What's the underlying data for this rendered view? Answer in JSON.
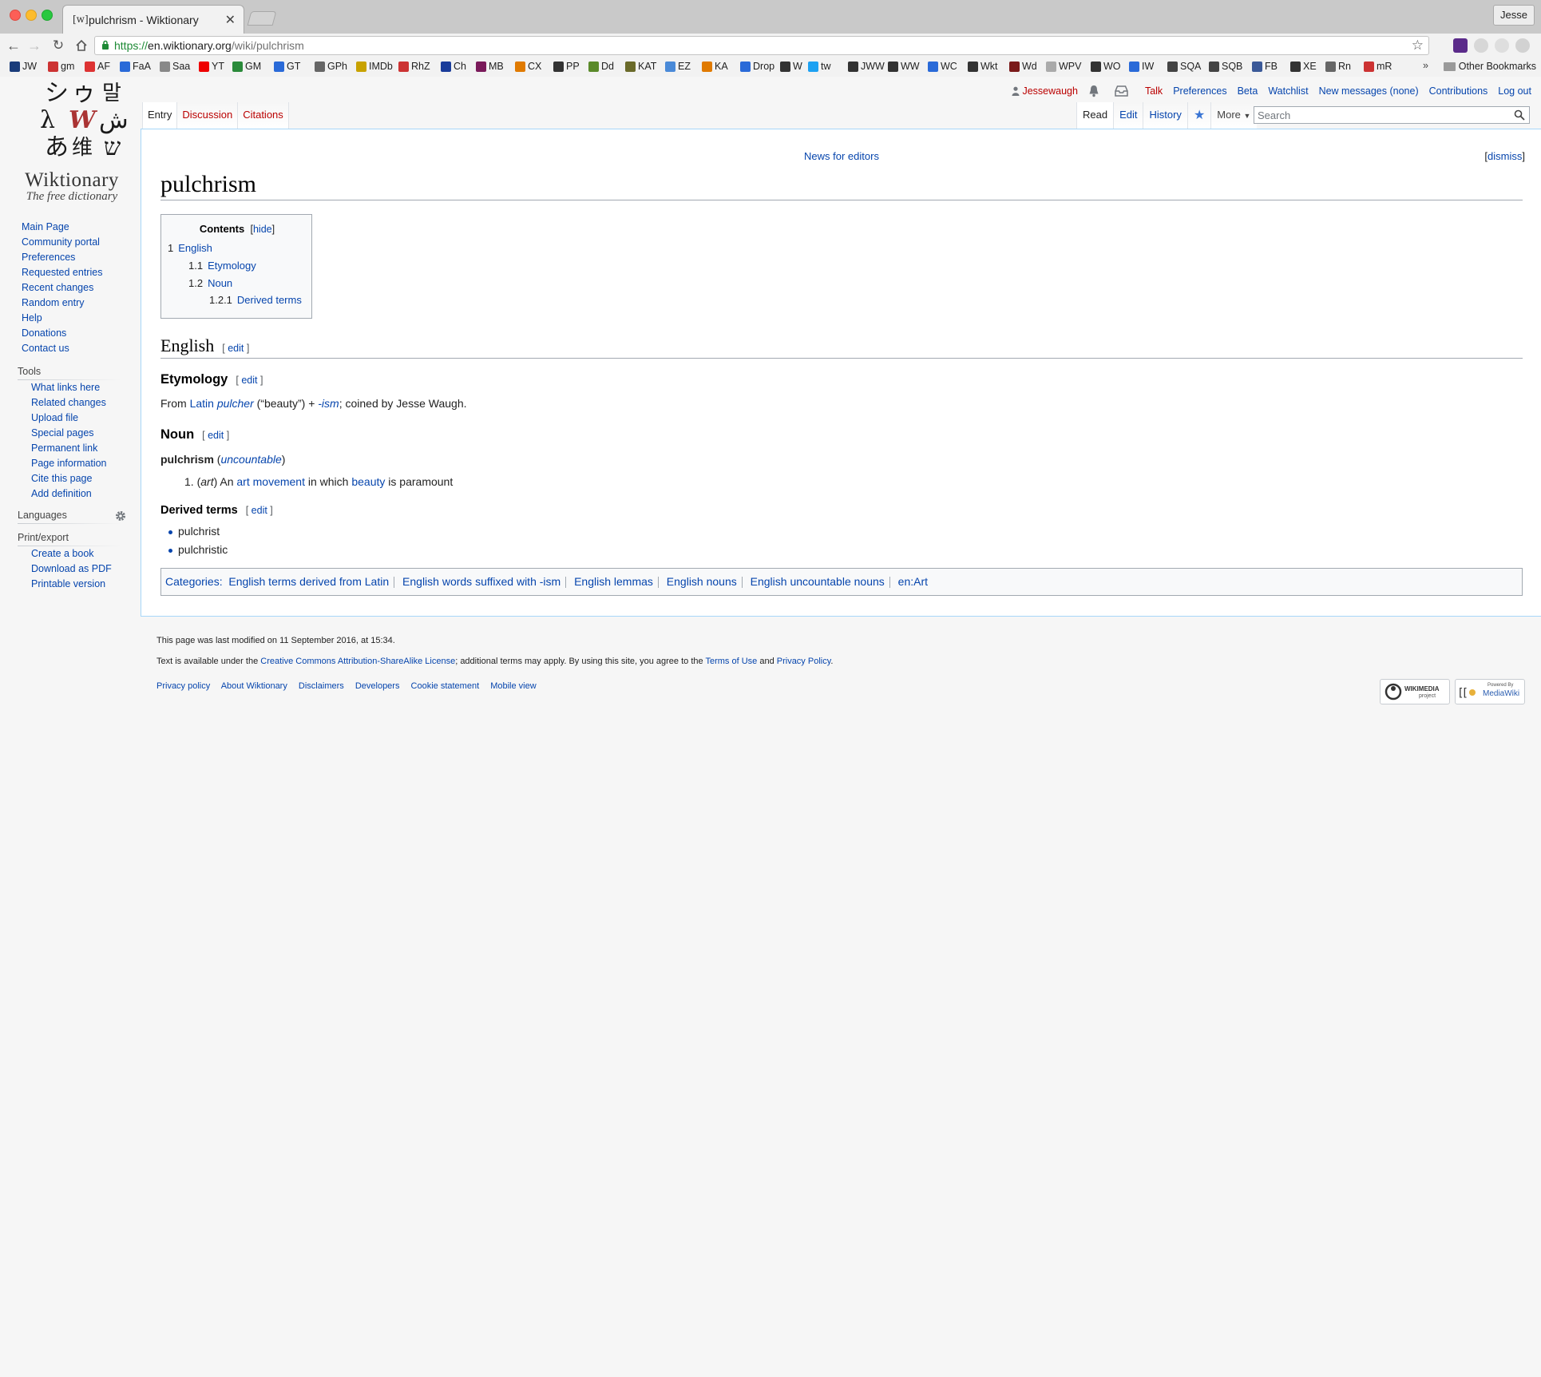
{
  "browser": {
    "tab_title": "pulchrism - Wiktionary",
    "tab_favicon": "[w]",
    "profile": "Jesse",
    "url_scheme": "https://",
    "url_host": "en.wiktionary.org",
    "url_path": "/wiki/pulchrism",
    "bookmarks": [
      "JW",
      "gm",
      "AF",
      "FaA",
      "Saa",
      "YT",
      "GM",
      "GT",
      "GPh",
      "IMDb",
      "RhZ",
      "Ch",
      "MB",
      "CX",
      "PP",
      "Dd",
      "KAT",
      "EZ",
      "KA",
      "Drop",
      "W",
      "tw",
      "JWW",
      "WW",
      "WC",
      "Wkt",
      "Wd",
      "WPV",
      "WO",
      "IW",
      "SQA",
      "SQB",
      "FB",
      "XE",
      "Rn",
      "mR"
    ],
    "overflow": "»",
    "other_bookmarks": "Other Bookmarks"
  },
  "logo": {
    "wordmark": "Wiktionary",
    "tagline": "The free dictionary"
  },
  "sidebar": {
    "nav": [
      "Main Page",
      "Community portal",
      "Preferences",
      "Requested entries",
      "Recent changes",
      "Random entry",
      "Help",
      "Donations",
      "Contact us"
    ],
    "tools_heading": "Tools",
    "tools": [
      "What links here",
      "Related changes",
      "Upload file",
      "Special pages",
      "Permanent link",
      "Page information",
      "Cite this page",
      "Add definition"
    ],
    "languages_heading": "Languages",
    "print_heading": "Print/export",
    "print": [
      "Create a book",
      "Download as PDF",
      "Printable version"
    ]
  },
  "personal": {
    "user": "Jessewaugh",
    "links": [
      "Talk",
      "Preferences",
      "Beta",
      "Watchlist",
      "New messages (none)",
      "Contributions",
      "Log out"
    ]
  },
  "tabs": {
    "left": [
      "Entry",
      "Discussion",
      "Citations"
    ],
    "right": [
      "Read",
      "Edit",
      "History"
    ],
    "more": "More",
    "search_placeholder": "Search"
  },
  "notice": {
    "text": "News for editors",
    "dismiss": "dismiss"
  },
  "page": {
    "title": "pulchrism",
    "toc": {
      "title": "Contents",
      "hide": "hide",
      "entries": [
        {
          "num": "1",
          "label": "English"
        },
        {
          "num": "1.1",
          "label": "Etymology"
        },
        {
          "num": "1.2",
          "label": "Noun"
        },
        {
          "num": "1.2.1",
          "label": "Derived terms"
        }
      ]
    },
    "edit_label": "edit",
    "english_heading": "English",
    "etymology_heading": "Etymology",
    "etymology": {
      "from": "From",
      "latin": "Latin",
      "pulcher": "pulcher",
      "gloss": "(“beauty”) +",
      "ism": "-ism",
      "rest": "; coined by Jesse Waugh."
    },
    "noun_heading": "Noun",
    "headword": "pulchrism",
    "headword_qualifier": "uncountable",
    "definition": {
      "num": "1.",
      "label": "art",
      "pre": "An",
      "link1": "art",
      "link2": "movement",
      "mid": "in which",
      "link3": "beauty",
      "post": "is paramount"
    },
    "derived_heading": "Derived terms",
    "derived": [
      "pulchrist",
      "pulchristic"
    ],
    "categories_label": "Categories:",
    "categories": [
      "English terms derived from Latin",
      "English words suffixed with -ism",
      "English lemmas",
      "English nouns",
      "English uncountable nouns",
      "en:Art"
    ]
  },
  "footer": {
    "modified": "This page was last modified on 11 September 2016, at 15:34.",
    "license_pre": "Text is available under the",
    "license_link": "Creative Commons Attribution-ShareAlike License",
    "license_mid": "; additional terms may apply. By using this site, you agree to the",
    "terms": "Terms of Use",
    "and": "and",
    "privacy": "Privacy Policy",
    "links": [
      "Privacy policy",
      "About Wiktionary",
      "Disclaimers",
      "Developers",
      "Cookie statement",
      "Mobile view"
    ],
    "badge1": "WIKIMEDIA",
    "badge1_sub": "project",
    "badge2_small": "Powered By",
    "badge2": "MediaWiki"
  }
}
